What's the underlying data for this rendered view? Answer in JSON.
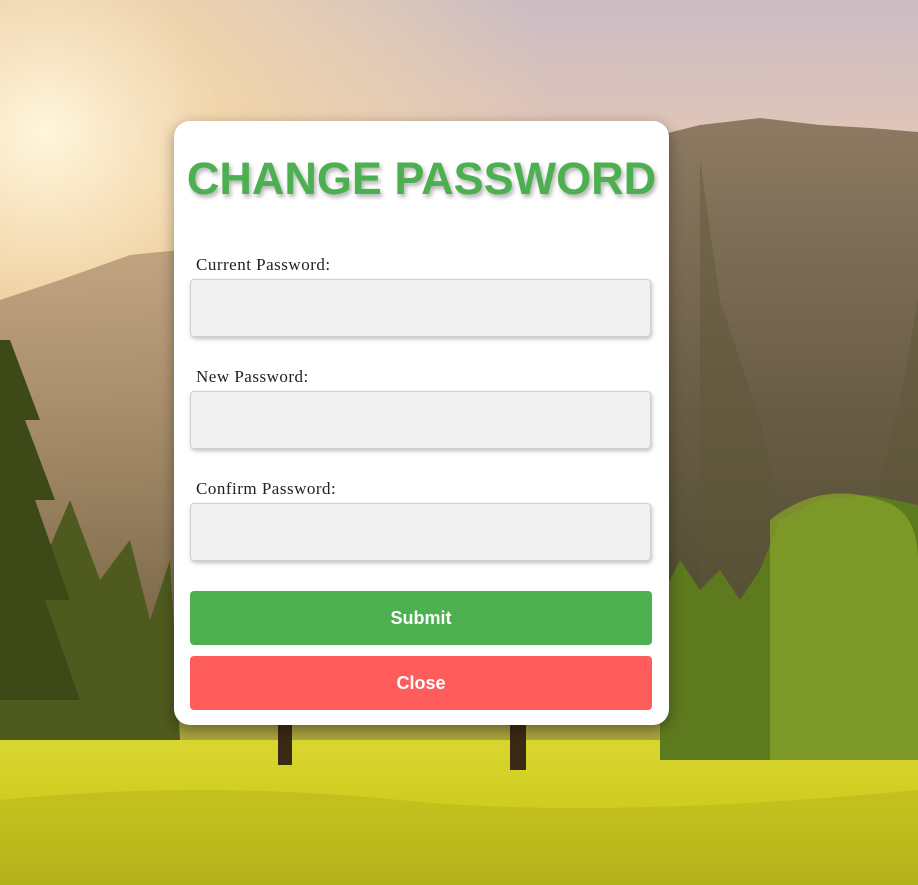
{
  "form": {
    "title": "CHANGE PASSWORD",
    "fields": [
      {
        "label": "Current Password:",
        "value": ""
      },
      {
        "label": "New Password:",
        "value": ""
      },
      {
        "label": "Confirm Password:",
        "value": ""
      }
    ],
    "submit_label": "Submit",
    "close_label": "Close"
  },
  "colors": {
    "title": "#4caf50",
    "submit_button": "#4caf50",
    "close_button": "#ff5c5c",
    "input_background": "#f1f1f1"
  }
}
